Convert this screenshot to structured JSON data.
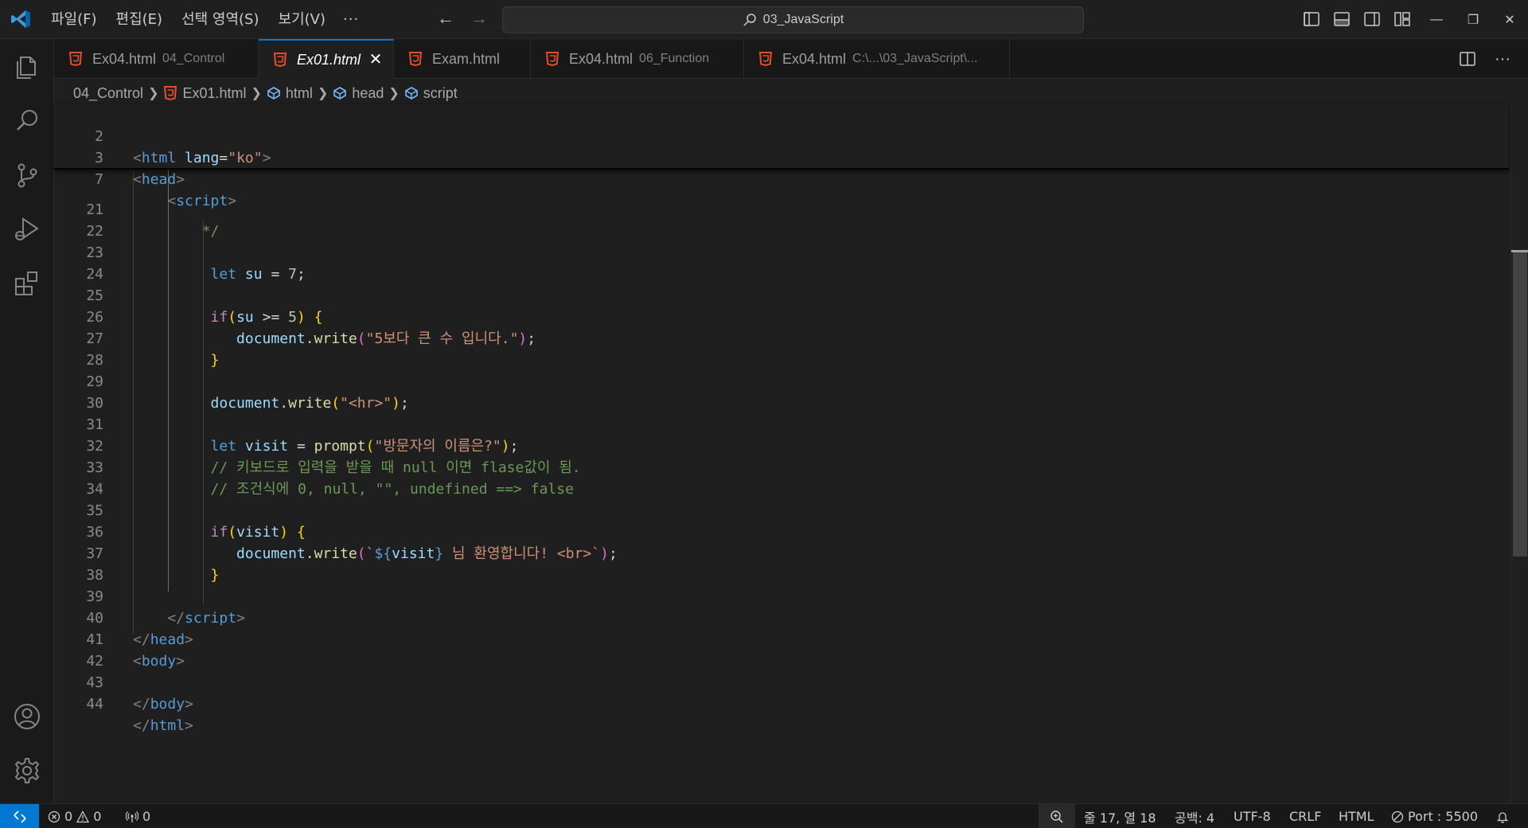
{
  "menu": {
    "items": [
      "파일(F)",
      "편집(E)",
      "선택 영역(S)",
      "보기(V)"
    ],
    "more": "···"
  },
  "command_center": {
    "text": "03_JavaScript"
  },
  "window_controls": {
    "minimize": "—",
    "restore": "❐",
    "close": "✕"
  },
  "tabs": [
    {
      "name": "Ex04.html",
      "desc": "04_Control",
      "active": false
    },
    {
      "name": "Ex01.html",
      "desc": "",
      "active": true
    },
    {
      "name": "Exam.html",
      "desc": "",
      "active": false
    },
    {
      "name": "Ex04.html",
      "desc": "06_Function",
      "active": false
    },
    {
      "name": "Ex04.html",
      "desc": "C:\\...\\03_JavaScript\\...",
      "active": false
    }
  ],
  "tab_close": "✕",
  "tab_more": "···",
  "breadcrumb": {
    "folder": "04_Control",
    "file": "Ex01.html",
    "sym1": "html",
    "sym2": "head",
    "sym3": "script"
  },
  "sticky_lines": [
    {
      "n": "2"
    },
    {
      "n": "3"
    },
    {
      "n": "7"
    }
  ],
  "code_lines": [
    {
      "n": "21"
    },
    {
      "n": "22"
    },
    {
      "n": "23"
    },
    {
      "n": "24"
    },
    {
      "n": "25"
    },
    {
      "n": "26"
    },
    {
      "n": "27"
    },
    {
      "n": "28"
    },
    {
      "n": "29"
    },
    {
      "n": "30"
    },
    {
      "n": "31"
    },
    {
      "n": "32"
    },
    {
      "n": "33"
    },
    {
      "n": "34"
    },
    {
      "n": "35"
    },
    {
      "n": "36"
    },
    {
      "n": "37"
    },
    {
      "n": "38"
    },
    {
      "n": "39"
    },
    {
      "n": "40"
    },
    {
      "n": "41"
    },
    {
      "n": "42"
    },
    {
      "n": "43"
    },
    {
      "n": "44"
    }
  ],
  "status": {
    "errors": "0",
    "warnings": "0",
    "ports": "0",
    "position": "줄 17, 열 18",
    "spaces": "공백: 4",
    "encoding": "UTF-8",
    "eol": "CRLF",
    "language": "HTML",
    "port": "Port : 5500"
  },
  "colors": {
    "accent": "#0078d4",
    "html_icon": "#e44d26",
    "background": "#1f1f1f"
  },
  "icons": [
    "vscode-logo",
    "explorer-icon",
    "search-icon",
    "source-control-icon",
    "run-debug-icon",
    "extensions-icon",
    "account-icon",
    "gear-icon",
    "html-file-icon",
    "symbol-icon",
    "split-editor-icon",
    "bell-icon",
    "zoom-icon",
    "remote-icon",
    "error-icon",
    "warning-icon",
    "broadcast-icon",
    "port-icon"
  ]
}
